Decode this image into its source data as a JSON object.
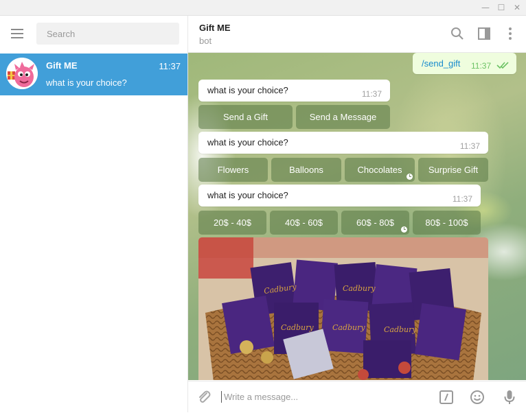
{
  "window": {
    "minimize_glyph": "—",
    "maximize_glyph": "☐",
    "close_glyph": "✕"
  },
  "sidebar": {
    "search_placeholder": "Search",
    "chats": [
      {
        "name": "Gift ME",
        "time": "11:37",
        "preview": "what is your choice?",
        "avatar_icon": "pink-monster-avatar-icon"
      }
    ]
  },
  "header": {
    "peer_name": "Gift ME",
    "peer_status": "bot",
    "icons": [
      "search-icon",
      "sidebar-toggle-icon",
      "more-vertical-icon"
    ]
  },
  "messages": {
    "outgoing": {
      "text": "/send_gift",
      "time": "11:37",
      "status": "read"
    },
    "incoming": [
      {
        "text": "what is your choice?",
        "time": "11:37",
        "buttons": [
          "Send a Gift",
          "Send a Message"
        ]
      },
      {
        "text": "what is your choice?",
        "time": "11:37",
        "buttons": [
          "Flowers",
          "Balloons",
          "Chocolates",
          "Surprise Gift"
        ]
      },
      {
        "text": "what is your choice?",
        "time": "11:37",
        "buttons": [
          "20$ - 40$",
          "40$ - 60$",
          "60$ - 80$",
          "80$ - 100$"
        ]
      }
    ],
    "photo": {
      "description": "basket-of-cadbury-chocolates-image",
      "label": "Cadbury"
    }
  },
  "composer": {
    "placeholder": "Write a message...",
    "icons": [
      "attach-icon",
      "bot-command-icon",
      "emoji-icon",
      "microphone-icon"
    ]
  },
  "colors": {
    "accent": "#419fd9",
    "outgoing_bubble": "#effdde",
    "link": "#168acd",
    "read_check": "#6cc264"
  }
}
